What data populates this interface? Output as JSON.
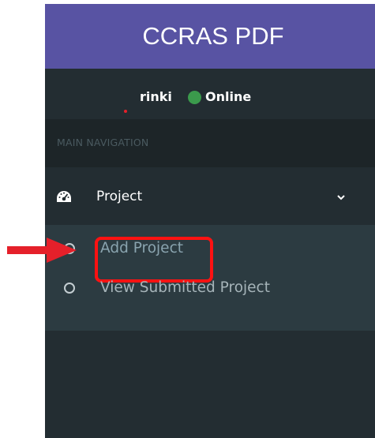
{
  "sidebar": {
    "brand": "CCRAS PDF",
    "user": {
      "name": "rinki",
      "status": "Online",
      "status_color": "#3b9a4c"
    },
    "nav_header": "MAIN NAVIGATION",
    "menu": {
      "label": "Project",
      "icon": "dashboard-icon",
      "expanded": true,
      "subitems": [
        {
          "label": "Add Project",
          "icon": "circle-icon",
          "highlighted": true
        },
        {
          "label": "View Submitted Project",
          "icon": "circle-icon"
        }
      ]
    }
  },
  "colors": {
    "brand_bg": "#5853a3",
    "sidebar_bg": "#232d32",
    "submenu_bg": "#2c3b41",
    "annotation": "#ff1212"
  },
  "annotation": {
    "arrow": "right-arrow-icon",
    "box": "highlight-box"
  }
}
